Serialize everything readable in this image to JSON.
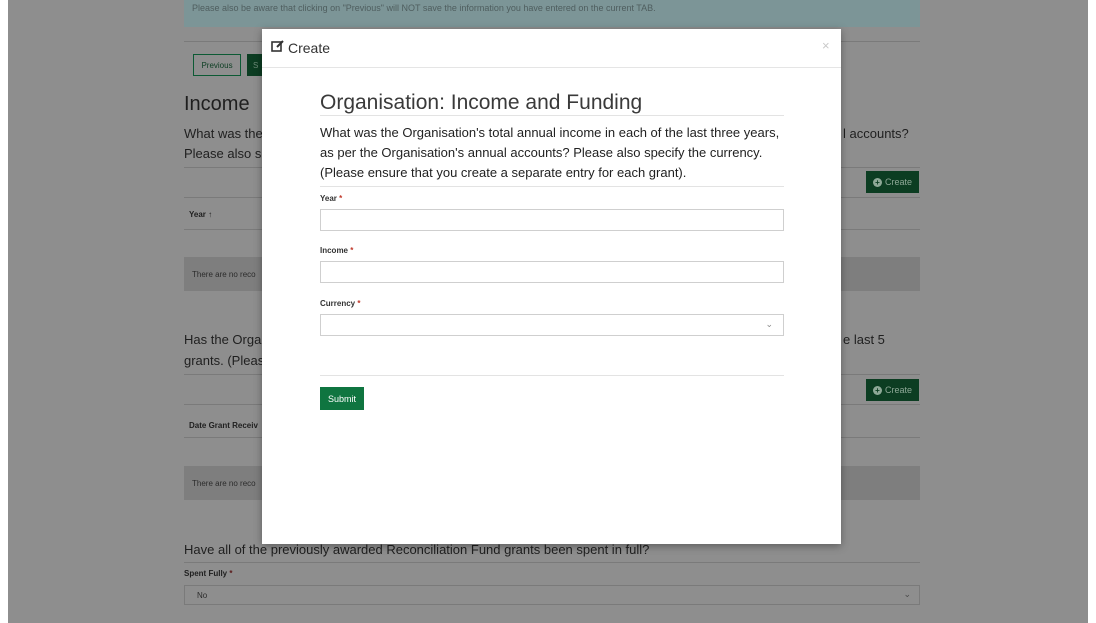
{
  "background": {
    "notice": "Please also be aware that clicking on \"Previous\" will NOT save the information you have entered on the current TAB.",
    "previous_label": "Previous",
    "save_label": "S",
    "heading": "Income",
    "q1_line1_left": "What was the",
    "q1_line1_right": "l accounts?",
    "q1_line2_left": "Please also sp",
    "create_label": "Create",
    "table1_header": "Year",
    "empty_text": "There are no reco",
    "q2_line1_left": "Has the Orga",
    "q2_line1_right": "e last 5",
    "q2_line2_left": "grants. (Pleas",
    "table2_header": "Date Grant Receiv",
    "q3_text": "Have all of the previously awarded Reconciliation Fund grants been spent in full?",
    "spent_label": "Spent Fully",
    "spent_value": "No"
  },
  "modal": {
    "title": "Create",
    "close": "×",
    "form_title": "Organisation: Income and Funding",
    "description": "What was the Organisation's total annual income in each of the last three years, as per the Organisation's annual accounts? Please also specify the currency. (Please ensure that you create a separate entry for each grant).",
    "fields": [
      {
        "label": "Year",
        "value": ""
      },
      {
        "label": "Income",
        "value": ""
      },
      {
        "label": "Currency",
        "value": ""
      }
    ],
    "required_mark": "*",
    "submit_label": "Submit"
  },
  "colors": {
    "brand_green": "#0f7540",
    "required_red": "#c0392b"
  }
}
